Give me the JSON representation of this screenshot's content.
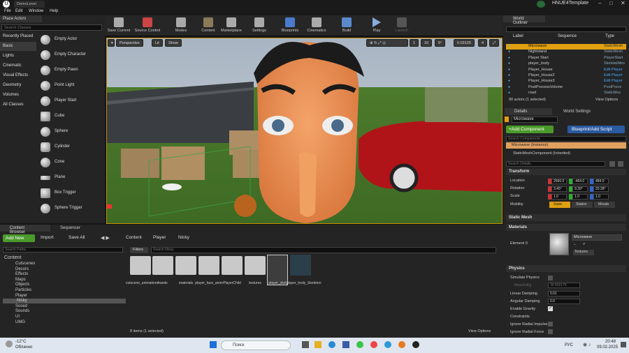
{
  "window": {
    "tab_title": "DemoLevel",
    "project_name": "HNUE4Template"
  },
  "menu": [
    "File",
    "Edit",
    "Window",
    "Help"
  ],
  "place_actors": {
    "tab": "Place Actors",
    "search_placeholder": "Search Classes",
    "categories": [
      "Recently Placed",
      "Basic",
      "Lights",
      "Cinematic",
      "Visual Effects",
      "Geometry",
      "Volumes",
      "All Classes"
    ],
    "actors": [
      "Empty Actor",
      "Empty Character",
      "Empty Pawn",
      "Point Light",
      "Player Start",
      "Cube",
      "Sphere",
      "Cylinder",
      "Cone",
      "Plane",
      "Box Trigger",
      "Sphere Trigger"
    ]
  },
  "toolbar": [
    "Save Current",
    "Source Control",
    "Modes",
    "Content",
    "Marketplace",
    "Settings",
    "Blueprints",
    "Cinematics",
    "Build",
    "Play",
    "Launch"
  ],
  "viewport": {
    "perspective": "Perspective",
    "lit": "Lit",
    "show": "Show",
    "grid_snap": "10",
    "angle_snap": "5°",
    "scale_snap": "0.03125",
    "speed": "4",
    "num_1": "1"
  },
  "outliner": {
    "tab": "World Outliner",
    "col_label": "Label",
    "col_sequence": "Sequence",
    "col_type": "Type",
    "rows": [
      {
        "label": "Microwave",
        "type": "StaticMesh"
      },
      {
        "label": "Nightstand",
        "type": "StaticMesh"
      },
      {
        "label": "Player Start",
        "type": "PlayerStart"
      },
      {
        "label": "player_body",
        "type": "SkeletalMes"
      },
      {
        "label": "Player_House",
        "type": "Edit Player"
      },
      {
        "label": "Player_House2",
        "type": "Edit Player"
      },
      {
        "label": "Player_House3",
        "type": "Edit Player"
      },
      {
        "label": "PostProcessVolume",
        "type": "PostProce"
      },
      {
        "label": "road",
        "type": "StaticMes"
      }
    ],
    "status": "90 actors (1 selected)",
    "view_options": "View Options"
  },
  "details": {
    "tab": "Details",
    "tab2": "World Settings",
    "name": "Microwave",
    "add_component": "+Add Component",
    "blueprint_button": "Blueprint/Add Script",
    "search_components": "Search Components",
    "instance": "Microwave (Instance)",
    "component": "StaticMeshComponent (Inherited)",
    "search_details": "Search Details",
    "transform": "Transform",
    "location_label": "Location",
    "location": [
      "2560.0",
      "-464.0",
      "484.0"
    ],
    "rotation_label": "Rotation",
    "rotation": [
      "3.45°",
      "9.39°",
      "20.28°"
    ],
    "scale_label": "Scale",
    "scale": [
      "1.0",
      "1.0",
      "1.0"
    ],
    "mobility_label": "Mobility",
    "mobility": [
      "Static",
      "Station",
      "Movab"
    ],
    "static_mesh": "Static Mesh",
    "materials": "Materials",
    "element0": "Element 0",
    "material_name": "Microwave",
    "textures": "Textures",
    "physics": "Physics",
    "simulate_physics": "Simulate Physics",
    "mass_kg": "MassInKg",
    "mass_value": "30.832176",
    "linear_damping": "Linear Damping",
    "linear_damping_value": "0.01",
    "angular_damping": "Angular Damping",
    "angular_damping_value": "0.0",
    "enable_gravity": "Enable Gravity",
    "constraints": "Constraints",
    "ignore_radial_impulse": "Ignore Radial Impulse",
    "ignore_radial_force": "Ignore Radial Force"
  },
  "content_browser": {
    "tab": "Content Browser",
    "tab2": "Sequencer",
    "add_new": "Add New",
    "import": "Import",
    "save_all": "Save All",
    "path": [
      "Content",
      "Player",
      "Nicky"
    ],
    "search_paths": "Search Paths",
    "filters": "Filters",
    "search_placeholder": "Search Nicky",
    "tree": [
      "Content",
      "Cutscenes",
      "Decors",
      "Effects",
      "Maps",
      "Objects",
      "Particles",
      "Player",
      "Nicky",
      "Sosed",
      "Sounds",
      "UI",
      "UMG"
    ],
    "assets": [
      "cutscene_animations",
      "hands",
      "materials",
      "player_face_anim",
      "PlayerChild",
      "textures",
      "player_skel",
      "player_body_Skeleton"
    ],
    "status": "8 items (1 selected)",
    "view_options": "View Options"
  },
  "taskbar": {
    "weather_temp": "-12°C",
    "weather_desc": "Облачно",
    "search": "Поиск",
    "lang": "РУС",
    "time": "20:48",
    "date": "09.02.2025"
  }
}
